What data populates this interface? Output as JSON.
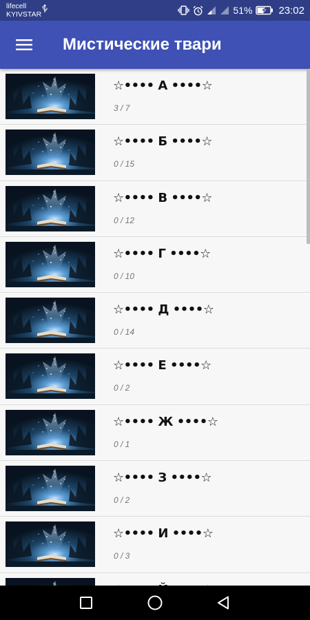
{
  "status_bar": {
    "carrier_line1": "lifecell",
    "carrier_line2": "KYIVSTAR",
    "battery": "51%",
    "time": "23:02",
    "icons": [
      "usb-icon",
      "vibrate-icon",
      "alarm-icon",
      "signal-icon",
      "signal-icon",
      "wifi-icon",
      "battery-charging-icon"
    ]
  },
  "app_bar": {
    "title": "Мистические твари",
    "menu_icon": "hamburger-menu-icon"
  },
  "list": {
    "items": [
      {
        "title": "☆•••• А ••••☆",
        "count": "3 / 7"
      },
      {
        "title": "☆•••• Б ••••☆",
        "count": "0 / 15"
      },
      {
        "title": "☆•••• В ••••☆",
        "count": "0 / 12"
      },
      {
        "title": "☆•••• Г ••••☆",
        "count": "0 / 10"
      },
      {
        "title": "☆•••• Д ••••☆",
        "count": "0 / 14"
      },
      {
        "title": "☆•••• Е ••••☆",
        "count": "0 / 2"
      },
      {
        "title": "☆•••• Ж ••••☆",
        "count": "0 / 1"
      },
      {
        "title": "☆•••• З ••••☆",
        "count": "0 / 2"
      },
      {
        "title": "☆•••• И ••••☆",
        "count": "0 / 3"
      },
      {
        "title": "☆•••• Й ••••☆",
        "count": ""
      }
    ]
  },
  "nav_bar": {
    "icons": [
      "recents-square-icon",
      "home-circle-icon",
      "back-triangle-icon"
    ]
  },
  "colors": {
    "status_bar": "#2f3e86",
    "app_bar": "#3f51b5",
    "list_background": "#f7f7f7",
    "count_text": "#757575"
  }
}
